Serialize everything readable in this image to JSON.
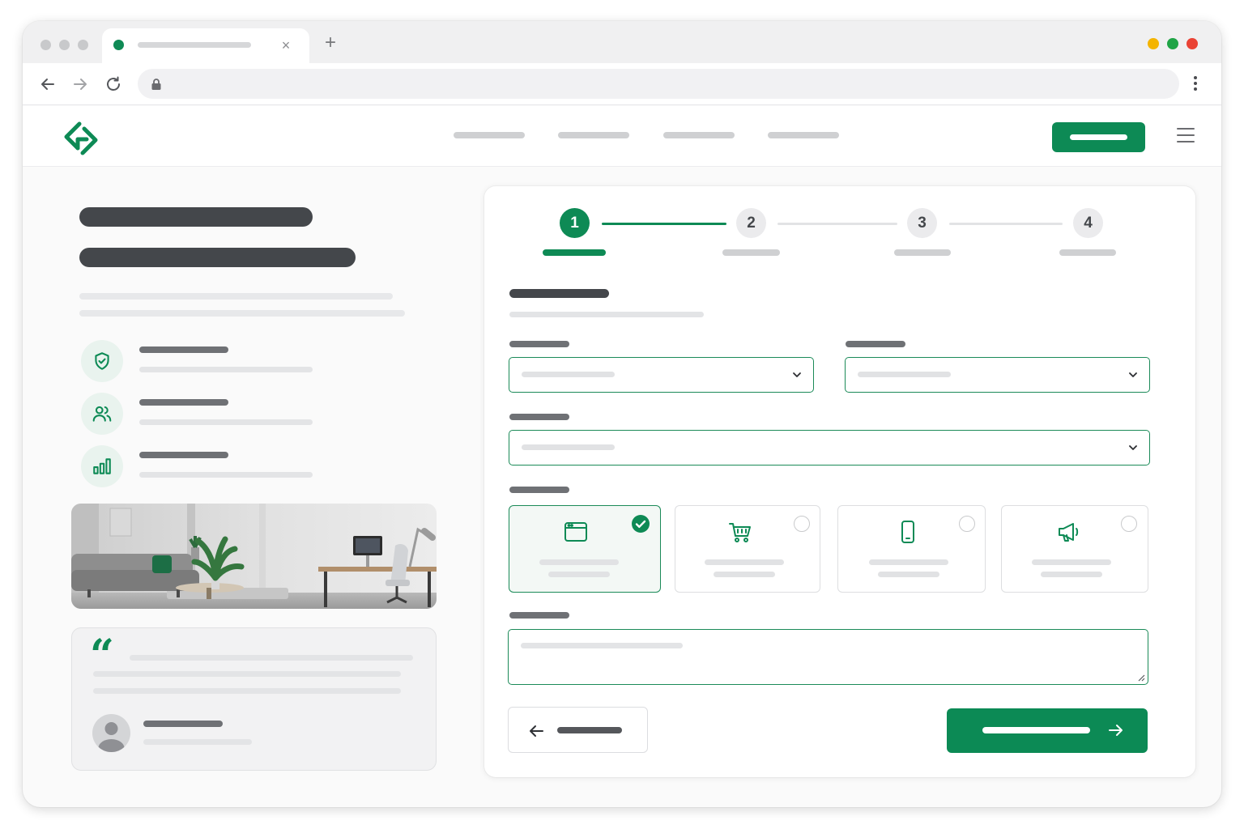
{
  "browser": {
    "tab": {
      "title": "",
      "favicon_color": "#0f8a55",
      "close_glyph": "×"
    },
    "new_tab_glyph": "+",
    "address": {
      "url": ""
    },
    "icons": [
      "back-arrow-icon",
      "forward-arrow-icon",
      "reload-icon",
      "lock-icon",
      "kebab-menu-icon"
    ],
    "window_controls": [
      "#f4b400",
      "#1fa446",
      "#ea4335"
    ]
  },
  "site": {
    "brand_color": "#0d8a55",
    "nav": {
      "links": [
        "",
        "",
        "",
        ""
      ],
      "cta_label": ""
    },
    "hero": {
      "title_line_1": "",
      "title_line_2": "",
      "description": ""
    },
    "features": [
      {
        "icon": "shield-check-icon",
        "title": "",
        "text": ""
      },
      {
        "icon": "users-icon",
        "title": "",
        "text": ""
      },
      {
        "icon": "bar-chart-icon",
        "title": "",
        "text": ""
      }
    ],
    "image": {
      "subject": "office-living-room-photo"
    },
    "testimonial": {
      "quote_glyph": "“",
      "text": "",
      "author_name": "",
      "author_role": ""
    }
  },
  "wizard": {
    "steps": [
      {
        "number": "1",
        "label": "",
        "state": "active"
      },
      {
        "number": "2",
        "label": "",
        "state": "upcoming"
      },
      {
        "number": "3",
        "label": "",
        "state": "upcoming"
      },
      {
        "number": "4",
        "label": "",
        "state": "upcoming"
      }
    ],
    "progress_complete": 0.25,
    "section_title": "",
    "section_subtitle": "",
    "fields": {
      "select_1": {
        "label": "",
        "placeholder": ""
      },
      "select_2": {
        "label": "",
        "placeholder": ""
      },
      "select_3": {
        "label": "",
        "placeholder": ""
      }
    },
    "options_label": "",
    "options": [
      {
        "icon": "browser-window-icon",
        "title": "",
        "desc": "",
        "selected": true
      },
      {
        "icon": "shopping-cart-icon",
        "title": "",
        "desc": "",
        "selected": false
      },
      {
        "icon": "smartphone-icon",
        "title": "",
        "desc": "",
        "selected": false
      },
      {
        "icon": "megaphone-icon",
        "title": "",
        "desc": "",
        "selected": false
      }
    ],
    "message": {
      "label": "",
      "placeholder": ""
    },
    "buttons": {
      "back_label": "",
      "next_label": ""
    }
  }
}
